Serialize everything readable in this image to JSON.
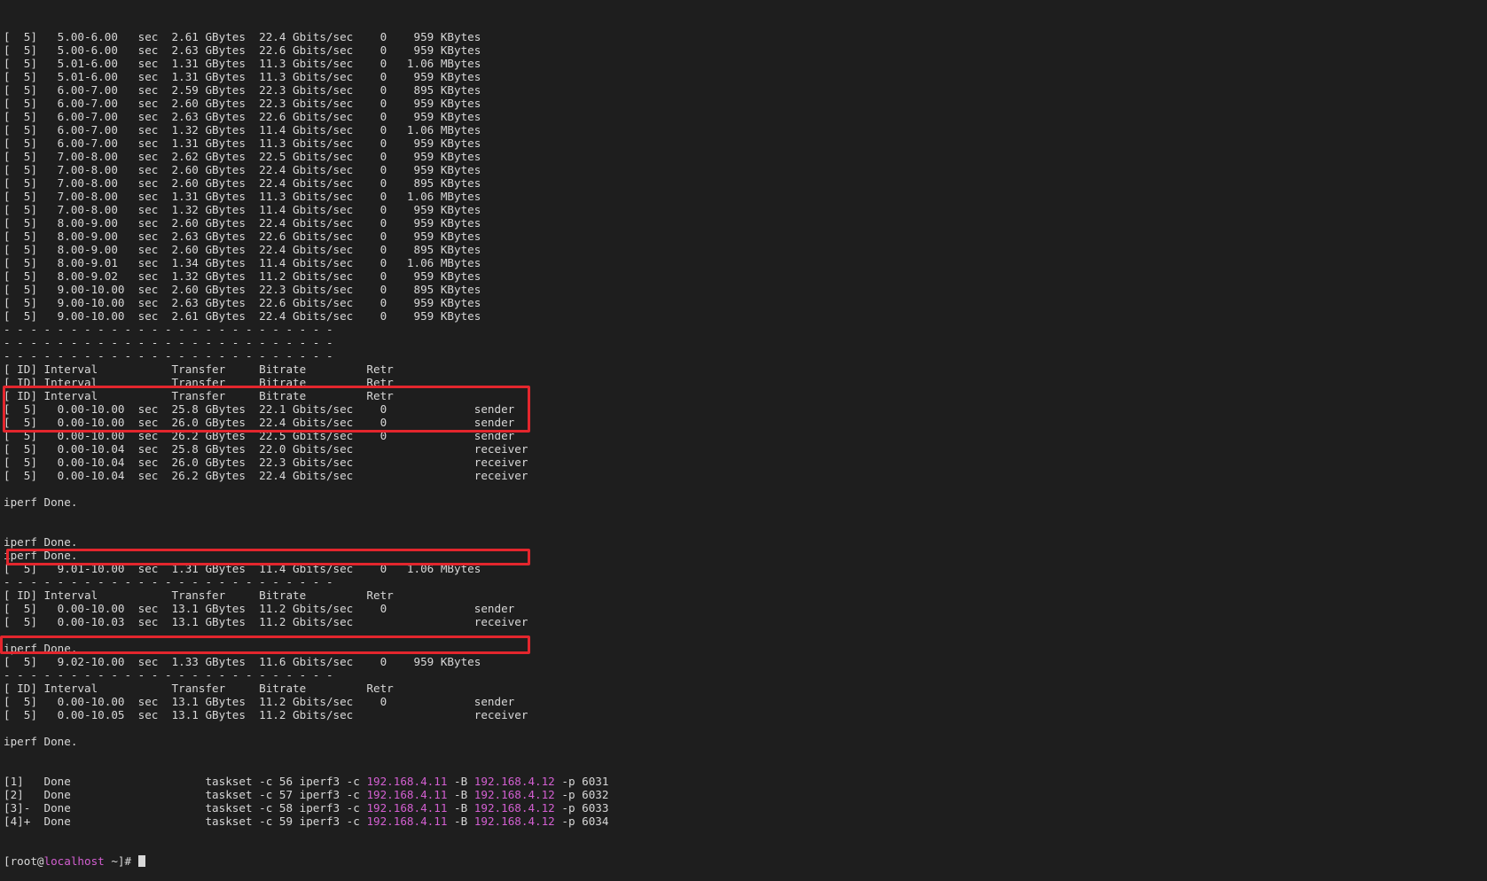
{
  "colors": {
    "background": "#1e1e1e",
    "text": "#d8d8d8",
    "ip_highlight": "#d35fd1",
    "box_highlight": "#e3262d"
  },
  "terminal": {
    "lines": [
      "[  5]   5.00-6.00   sec  2.61 GBytes  22.4 Gbits/sec    0    959 KBytes",
      "[  5]   5.00-6.00   sec  2.63 GBytes  22.6 Gbits/sec    0    959 KBytes",
      "[  5]   5.01-6.00   sec  1.31 GBytes  11.3 Gbits/sec    0   1.06 MBytes",
      "[  5]   5.01-6.00   sec  1.31 GBytes  11.3 Gbits/sec    0    959 KBytes",
      "[  5]   6.00-7.00   sec  2.59 GBytes  22.3 Gbits/sec    0    895 KBytes",
      "[  5]   6.00-7.00   sec  2.60 GBytes  22.3 Gbits/sec    0    959 KBytes",
      "[  5]   6.00-7.00   sec  2.63 GBytes  22.6 Gbits/sec    0    959 KBytes",
      "[  5]   6.00-7.00   sec  1.32 GBytes  11.4 Gbits/sec    0   1.06 MBytes",
      "[  5]   6.00-7.00   sec  1.31 GBytes  11.3 Gbits/sec    0    959 KBytes",
      "[  5]   7.00-8.00   sec  2.62 GBytes  22.5 Gbits/sec    0    959 KBytes",
      "[  5]   7.00-8.00   sec  2.60 GBytes  22.4 Gbits/sec    0    959 KBytes",
      "[  5]   7.00-8.00   sec  2.60 GBytes  22.4 Gbits/sec    0    895 KBytes",
      "[  5]   7.00-8.00   sec  1.31 GBytes  11.3 Gbits/sec    0   1.06 MBytes",
      "[  5]   7.00-8.00   sec  1.32 GBytes  11.4 Gbits/sec    0    959 KBytes",
      "[  5]   8.00-9.00   sec  2.60 GBytes  22.4 Gbits/sec    0    959 KBytes",
      "[  5]   8.00-9.00   sec  2.63 GBytes  22.6 Gbits/sec    0    959 KBytes",
      "[  5]   8.00-9.00   sec  2.60 GBytes  22.4 Gbits/sec    0    895 KBytes",
      "[  5]   8.00-9.01   sec  1.34 GBytes  11.4 Gbits/sec    0   1.06 MBytes",
      "[  5]   8.00-9.02   sec  1.32 GBytes  11.2 Gbits/sec    0    959 KBytes",
      "[  5]   9.00-10.00  sec  2.60 GBytes  22.3 Gbits/sec    0    895 KBytes",
      "[  5]   9.00-10.00  sec  2.63 GBytes  22.6 Gbits/sec    0    959 KBytes",
      "[  5]   9.00-10.00  sec  2.61 GBytes  22.4 Gbits/sec    0    959 KBytes",
      "- - - - - - - - - - - - - - - - - - - - - - - - -",
      "- - - - - - - - - - - - - - - - - - - - - - - - -",
      "- - - - - - - - - - - - - - - - - - - - - - - - -",
      "[ ID] Interval           Transfer     Bitrate         Retr",
      "[ ID] Interval           Transfer     Bitrate         Retr",
      "[ ID] Interval           Transfer     Bitrate         Retr",
      "[  5]   0.00-10.00  sec  25.8 GBytes  22.1 Gbits/sec    0             sender",
      "[  5]   0.00-10.00  sec  26.0 GBytes  22.4 Gbits/sec    0             sender",
      "[  5]   0.00-10.00  sec  26.2 GBytes  22.5 Gbits/sec    0             sender",
      "[  5]   0.00-10.04  sec  25.8 GBytes  22.0 Gbits/sec                  receiver",
      "[  5]   0.00-10.04  sec  26.0 GBytes  22.3 Gbits/sec                  receiver",
      "[  5]   0.00-10.04  sec  26.2 GBytes  22.4 Gbits/sec                  receiver",
      "",
      "iperf Done.",
      "",
      "",
      "iperf Done.",
      "iperf Done.",
      "[  5]   9.01-10.00  sec  1.31 GBytes  11.4 Gbits/sec    0   1.06 MBytes",
      "- - - - - - - - - - - - - - - - - - - - - - - - -",
      "[ ID] Interval           Transfer     Bitrate         Retr",
      "[  5]   0.00-10.00  sec  13.1 GBytes  11.2 Gbits/sec    0             sender",
      "[  5]   0.00-10.03  sec  13.1 GBytes  11.2 Gbits/sec                  receiver",
      "",
      "iperf Done.",
      "[  5]   9.02-10.00  sec  1.33 GBytes  11.6 Gbits/sec    0    959 KBytes",
      "- - - - - - - - - - - - - - - - - - - - - - - - -",
      "[ ID] Interval           Transfer     Bitrate         Retr",
      "[  5]   0.00-10.00  sec  13.1 GBytes  11.2 Gbits/sec    0             sender",
      "[  5]   0.00-10.05  sec  13.1 GBytes  11.2 Gbits/sec                  receiver",
      "",
      "iperf Done."
    ],
    "jobs": [
      {
        "prefix": "[1]   Done                    taskset -c 56 iperf3 -c ",
        "client_ip": "192.168.4.11",
        "mid": " -B ",
        "bind_ip": "192.168.4.12",
        "suffix": " -p 6031"
      },
      {
        "prefix": "[2]   Done                    taskset -c 57 iperf3 -c ",
        "client_ip": "192.168.4.11",
        "mid": " -B ",
        "bind_ip": "192.168.4.12",
        "suffix": " -p 6032"
      },
      {
        "prefix": "[3]-  Done                    taskset -c 58 iperf3 -c ",
        "client_ip": "192.168.4.11",
        "mid": " -B ",
        "bind_ip": "192.168.4.12",
        "suffix": " -p 6033"
      },
      {
        "prefix": "[4]+  Done                    taskset -c 59 iperf3 -c ",
        "client_ip": "192.168.4.11",
        "mid": " -B ",
        "bind_ip": "192.168.4.12",
        "suffix": " -p 6034"
      }
    ],
    "prompt": {
      "open": "[root@",
      "host": "localhost",
      "close": " ~]# "
    }
  }
}
